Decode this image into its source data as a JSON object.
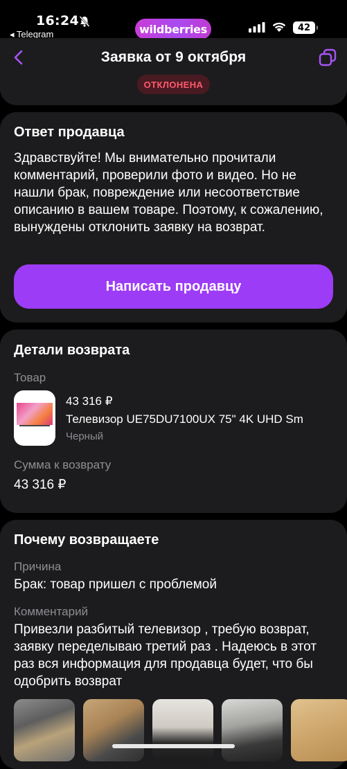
{
  "status_bar": {
    "time": "16:24",
    "back_app": "◂ Telegram",
    "logo": "wildberries",
    "battery": "42"
  },
  "header": {
    "title": "Заявка от 9 октября",
    "status": "ОТКЛОНЕНА"
  },
  "seller_answer": {
    "title": "Ответ продавца",
    "text": "Здравствуйте! Мы внимательно прочитали комментарий, проверили фото и видео. Но не нашли брак, повреждение или несоответствие описанию в вашем товаре. Поэтому, к сожалению, вынуждены отклонить заявку на возврат.",
    "button_label": "Написать продавцу"
  },
  "return_details": {
    "title": "Детали возврата",
    "product_label": "Товар",
    "product": {
      "price": "43 316 ₽",
      "name": "Телевизор UE75DU7100UX 75\" 4K UHD Sm",
      "color": "Черный"
    },
    "refund_label": "Сумма к возврату",
    "refund_amount": "43 316 ₽"
  },
  "reason": {
    "title": "Почему возвращаете",
    "reason_label": "Причина",
    "reason_value": "Брак: товар пришел с проблемой",
    "comment_label": "Комментарий",
    "comment_value": "Привезли разбитый телевизор , требую возврат, заявку переделываю третий раз . Надеюсь в этот раз вся информация для продавца будет, что бы одобрить возврат"
  },
  "colors": {
    "accent": "#9d3cf6",
    "card": "#1c1c1e",
    "status_red": "#ff5a6d"
  }
}
